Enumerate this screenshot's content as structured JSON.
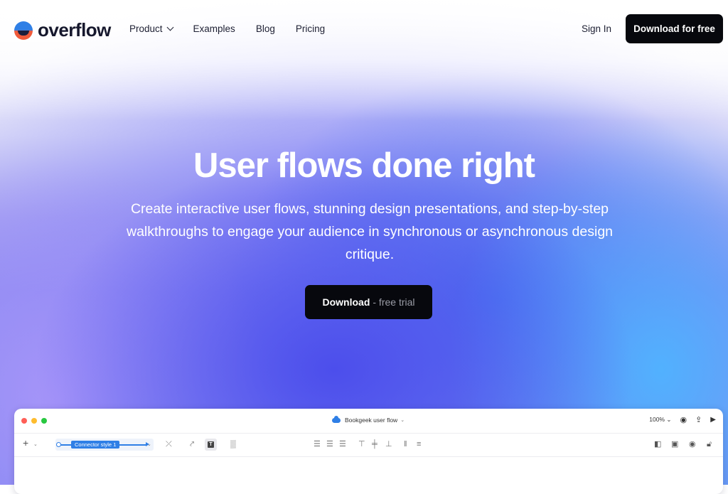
{
  "brand": {
    "name": "overflow"
  },
  "nav": {
    "items": [
      {
        "label": "Product",
        "has_dropdown": true
      },
      {
        "label": "Examples"
      },
      {
        "label": "Blog"
      },
      {
        "label": "Pricing"
      }
    ],
    "sign_in": "Sign In",
    "cta": "Download for free"
  },
  "hero": {
    "title": "User flows done right",
    "subtitle": "Create interactive user flows, stunning design presentations, and step-by-step walkthroughs to engage your audience in synchronous or asynchronous design critique.",
    "button_strong": "Download",
    "button_muted": "- free trial"
  },
  "app_preview": {
    "doc_title": "Bookgeek user flow",
    "zoom": "100%",
    "connector_style": "Connector style 1",
    "icons": [
      "add-icon",
      "connector-style-icon",
      "unlink-icon",
      "path-icon",
      "text-icon",
      "pattern-icon",
      "align-left-icon",
      "align-center-icon",
      "align-right-icon",
      "align-top-icon",
      "align-middle-icon",
      "align-bottom-icon",
      "distribute-horizontal-icon",
      "distribute-vertical-icon",
      "arrange-icon",
      "frame-icon",
      "preview-icon",
      "lock-icon",
      "user-icon",
      "share-icon",
      "play-icon",
      "cloud-icon"
    ]
  },
  "colors": {
    "accent": "#2f7fe6",
    "brand_orange": "#f05a3a",
    "button_dark": "#07080d",
    "hero_blue": "#4a52e8",
    "traffic_red": "#ff5f57",
    "traffic_yellow": "#febc2e",
    "traffic_green": "#28c840"
  }
}
